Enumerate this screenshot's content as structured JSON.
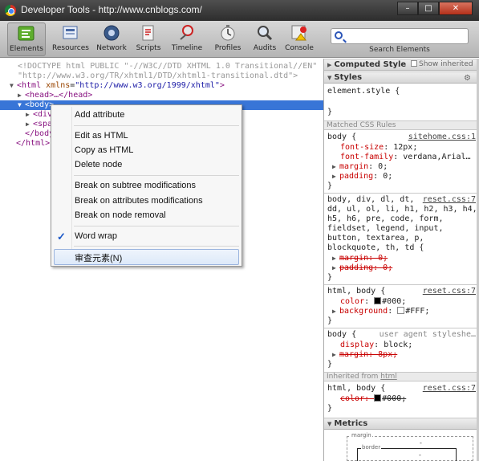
{
  "window": {
    "title": "Developer Tools - http://www.cnblogs.com/",
    "buttons": [
      "–",
      "□",
      "✕"
    ]
  },
  "toolbar": {
    "tabs": [
      {
        "label": "Elements",
        "icon": "elements-icon"
      },
      {
        "label": "Resources",
        "icon": "resources-icon"
      },
      {
        "label": "Network",
        "icon": "network-icon"
      },
      {
        "label": "Scripts",
        "icon": "scripts-icon"
      },
      {
        "label": "Timeline",
        "icon": "timeline-icon"
      },
      {
        "label": "Profiles",
        "icon": "profiles-icon"
      },
      {
        "label": "Audits",
        "icon": "audits-icon"
      },
      {
        "label": "Console",
        "icon": "console-icon"
      }
    ],
    "active_tab": "Elements",
    "search": {
      "placeholder": "",
      "label": "Search Elements"
    }
  },
  "dom": {
    "doctype_1": "<!DOCTYPE html PUBLIC \"-//W3C//DTD XHTML 1.0 Transitional//EN\"",
    "doctype_2": "\"http://www.w3.org/TR/xhtml1/DTD/xhtml1-transitional.dtd\">",
    "html_open": "<html",
    "html_attr": "xmlns",
    "html_val": "\"http://www.w3.org/1999/xhtml\"",
    "html_close_bracket": ">",
    "head": "<head>…</head>",
    "body_open": "<body>",
    "div_partial": "<div",
    "span_partial": "<spa",
    "body_close_partial": "</body",
    "html_close": "</html>"
  },
  "context_menu": {
    "items": [
      "Add attribute",
      "Edit as HTML",
      "Copy as HTML",
      "Delete node",
      "Break on subtree modifications",
      "Break on attributes modifications",
      "Break on node removal",
      "Word wrap",
      "审查元素(N)"
    ],
    "checked": "Word wrap",
    "check_mark": "✓"
  },
  "styles": {
    "computed_header": "Computed Style",
    "show_inherited": "Show inherited",
    "styles_header": "Styles",
    "gear": "⚙",
    "element_style": "element.style {",
    "close_brace": "}",
    "matched_header": "Matched CSS Rules",
    "rule1": {
      "selector": "body {",
      "source": "sitehome.css:1",
      "p1": "font-size",
      "v1": "12px;",
      "p2": "font-family",
      "v2": "verdana,Arial…",
      "p3": "margin",
      "v3": "0;",
      "p4": "padding",
      "v4": "0;"
    },
    "rule2": {
      "selector_1": "body, div, dl, dt,",
      "source": "reset.css:7",
      "selector_2": "dd, ul, ol, li, h1, h2, h3, h4,",
      "selector_3": "h5, h6, pre, code, form,",
      "selector_4": "fieldset, legend, input,",
      "selector_5": "button, textarea, p,",
      "selector_6": "blockquote, th, td {",
      "p1": "margin: 0;",
      "p2": "padding: 0;"
    },
    "rule3": {
      "selector": "html, body {",
      "source": "reset.css:7",
      "p1": "color",
      "v1": "#000;",
      "p2": "background",
      "v2": "#FFF;"
    },
    "rule4": {
      "selector": "body {",
      "source": "user agent styleshe…",
      "p1": "display",
      "v1": "block;",
      "p2": "margin: 8px;"
    },
    "inherited_label": "Inherited from",
    "inherited_link": "html",
    "rule5": {
      "selector": "html, body {",
      "source": "reset.css:7",
      "p1": "color: ",
      "v1": "#000;"
    },
    "metrics_header": "Metrics",
    "metrics": {
      "margin": "margin",
      "border": "border",
      "dash": "-"
    }
  },
  "colors": {
    "selection": "#3875d7",
    "swatch_black": "#000000",
    "swatch_white": "#FFFFFF"
  }
}
